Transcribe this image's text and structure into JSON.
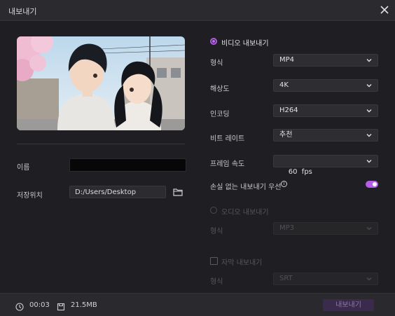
{
  "window": {
    "title": "내보내기"
  },
  "left": {
    "name_label": "이름",
    "name_value": "",
    "save_location_label": "저장위치",
    "save_path": "D:/Users/Desktop"
  },
  "video_export": {
    "title": "비디오 내보내기",
    "selected": true,
    "format": {
      "label": "형식",
      "value": "MP4"
    },
    "resolution": {
      "label": "해상도",
      "value": "4K"
    },
    "encoding": {
      "label": "인코딩",
      "value": "H264"
    },
    "bitrate": {
      "label": "비트 레이트",
      "value": "추천"
    },
    "frame_rate": {
      "label": "프레임 속도",
      "value": "60  fps"
    },
    "lossless": {
      "label": "손실 없는 내보내기 우선",
      "enabled": true,
      "info_symbol": "i"
    }
  },
  "audio_export": {
    "title": "오디오 내보내기",
    "selected": false,
    "format": {
      "label": "형식",
      "value": "MP3"
    }
  },
  "subtitle_export": {
    "title": "자막 내보내기",
    "checked": false,
    "format": {
      "label": "형식",
      "value": "SRT"
    }
  },
  "footer": {
    "duration": "00:03",
    "file_size": "21.5MB",
    "export_button": "내보내기"
  },
  "colors": {
    "accent": "#b45ee8",
    "background": "#1f1f23",
    "export_button_bg": "#3a2a4c"
  }
}
